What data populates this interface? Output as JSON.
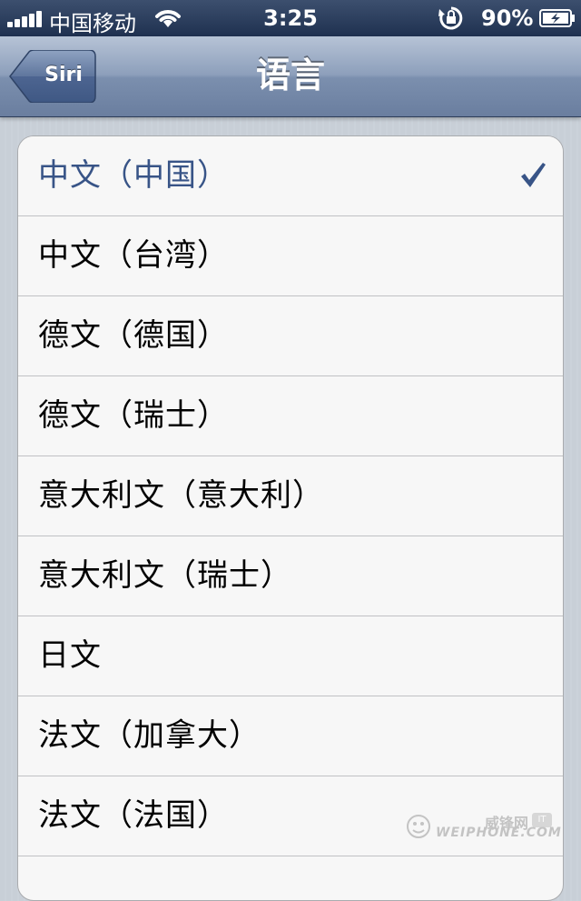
{
  "status_bar": {
    "carrier": "中国移动",
    "time": "3:25",
    "battery_percent": "90%",
    "icons": [
      "signal-bars-icon",
      "wifi-icon",
      "rotation-lock-icon",
      "battery-charging-icon"
    ]
  },
  "nav": {
    "back_label": "Siri",
    "title": "语言"
  },
  "languages": [
    {
      "label": "中文（中国）",
      "selected": true
    },
    {
      "label": "中文（台湾）",
      "selected": false
    },
    {
      "label": "德文（德国）",
      "selected": false
    },
    {
      "label": "德文（瑞士）",
      "selected": false
    },
    {
      "label": "意大利文（意大利）",
      "selected": false
    },
    {
      "label": "意大利文（瑞士）",
      "selected": false
    },
    {
      "label": "日文",
      "selected": false
    },
    {
      "label": "法文（加拿大）",
      "selected": false
    },
    {
      "label": "法文（法国）",
      "selected": false
    }
  ],
  "watermark": {
    "top_text": "威锋网",
    "badge": "IT",
    "bottom_text": "WEIPHONE.COM"
  },
  "colors": {
    "selected_text": "#385487",
    "checkmark": "#385487"
  }
}
